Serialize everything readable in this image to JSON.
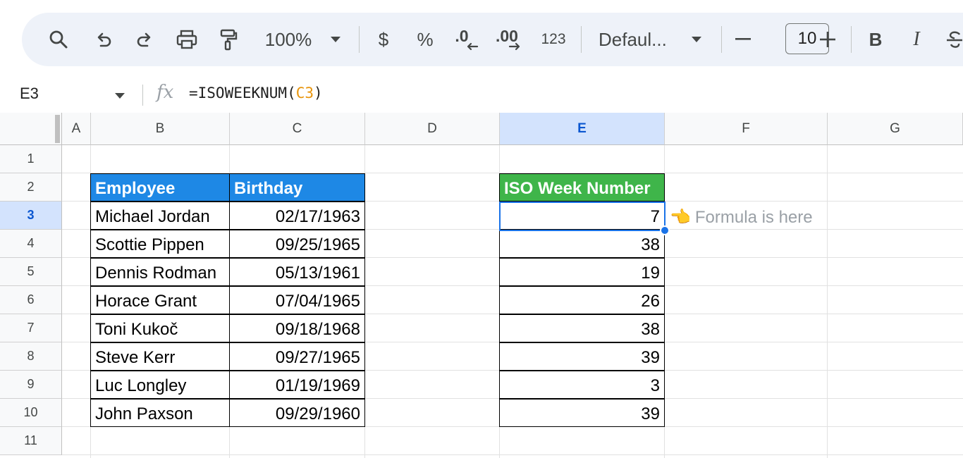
{
  "toolbar": {
    "zoom": "100%",
    "currency_label": "$",
    "percent_label": "%",
    "decrease_decimal_label": ".0",
    "increase_decimal_label": ".00",
    "number_format_label": "123",
    "font_name": "Defaul...",
    "font_size": "10",
    "bold_label": "B",
    "italic_label": "I"
  },
  "formula_bar": {
    "cell_ref": "E3",
    "formula_prefix": "=ISOWEEKNUM(",
    "formula_ref": "C3",
    "formula_suffix": ")"
  },
  "columns": [
    "A",
    "B",
    "C",
    "D",
    "E",
    "F",
    "G"
  ],
  "rows": [
    "1",
    "2",
    "3",
    "4",
    "5",
    "6",
    "7",
    "8",
    "9",
    "10",
    "11"
  ],
  "selected": {
    "column": "E",
    "row": "3"
  },
  "table": {
    "header_employee": "Employee",
    "header_birthday": "Birthday",
    "header_iso": "ISO Week Number",
    "employees": [
      {
        "name": "Michael Jordan",
        "birthday": "02/17/1963",
        "iso_week": "7"
      },
      {
        "name": "Scottie Pippen",
        "birthday": "09/25/1965",
        "iso_week": "38"
      },
      {
        "name": "Dennis Rodman",
        "birthday": "05/13/1961",
        "iso_week": "19"
      },
      {
        "name": "Horace Grant",
        "birthday": "07/04/1965",
        "iso_week": "26"
      },
      {
        "name": "Toni Kukoč",
        "birthday": "09/18/1968",
        "iso_week": "38"
      },
      {
        "name": "Steve Kerr",
        "birthday": "09/27/1965",
        "iso_week": "39"
      },
      {
        "name": "Luc Longley",
        "birthday": "01/19/1969",
        "iso_week": "3"
      },
      {
        "name": "John Paxson",
        "birthday": "09/29/1960",
        "iso_week": "39"
      }
    ]
  },
  "annotation": {
    "hand": "👈",
    "text": "Formula is here"
  },
  "colors": {
    "employee_header_bg": "#1e88e5",
    "iso_header_bg": "#3fb54a",
    "selection": "#1a73e8",
    "formula_ref": "#e8950d"
  },
  "icons": [
    "search-icon",
    "undo-icon",
    "redo-icon",
    "print-icon",
    "paint-format-icon",
    "chevron-down-icon",
    "minus-icon",
    "plus-icon",
    "strikethrough-icon",
    "fx-icon"
  ]
}
